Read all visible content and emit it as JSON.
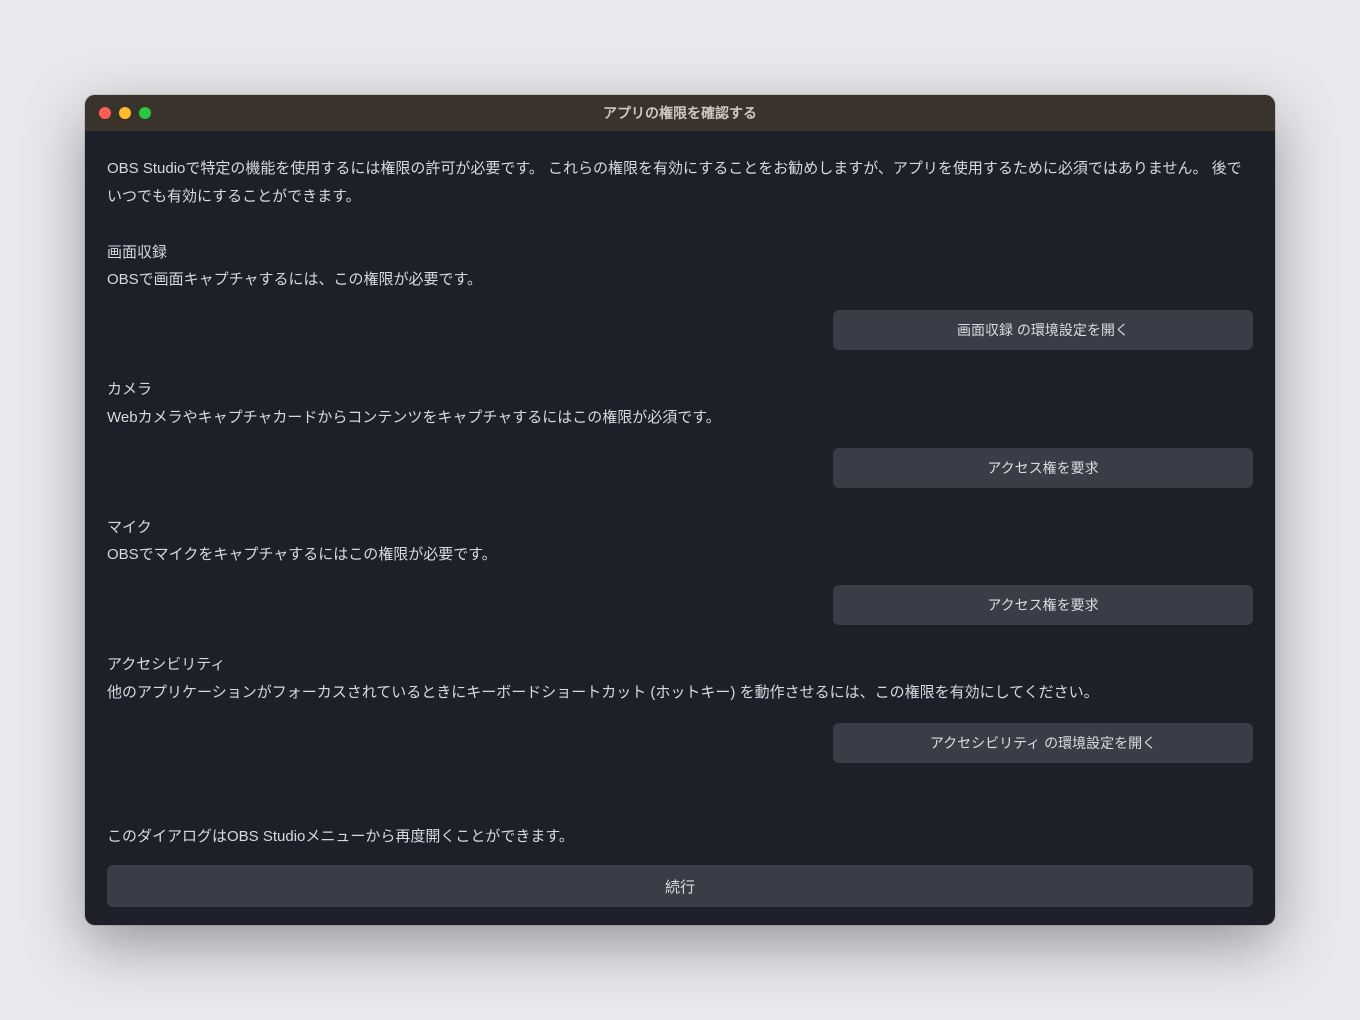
{
  "titlebar": {
    "title": "アプリの権限を確認する"
  },
  "intro": "OBS Studioで特定の機能を使用するには権限の許可が必要です。 これらの権限を有効にすることをお勧めしますが、アプリを使用するために必須ではありません。 後でいつでも有効にすることができます。",
  "sections": [
    {
      "title": "画面収録",
      "desc": "OBSで画面キャプチャするには、この権限が必要です。",
      "button": "画面収録 の環境設定を開く"
    },
    {
      "title": "カメラ",
      "desc": "Webカメラやキャプチャカードからコンテンツをキャプチャするにはこの権限が必須です。",
      "button": "アクセス権を要求"
    },
    {
      "title": "マイク",
      "desc": "OBSでマイクをキャプチャするにはこの権限が必要です。",
      "button": "アクセス権を要求"
    },
    {
      "title": "アクセシビリティ",
      "desc": "他のアプリケーションがフォーカスされているときにキーボードショートカット (ホットキー) を動作させるには、この権限を有効にしてください。",
      "button": "アクセシビリティ の環境設定を開く"
    }
  ],
  "footer": "このダイアログはOBS Studioメニューから再度開くことができます。",
  "continue_label": "続行"
}
